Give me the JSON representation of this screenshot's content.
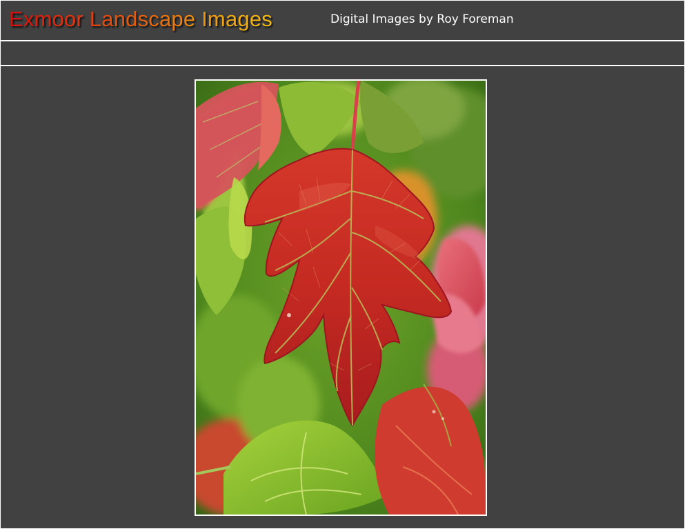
{
  "header": {
    "title": "Exmoor Landscape Images",
    "tagline": "Digital Images by Roy Foreman"
  },
  "nav": {
    "items": []
  },
  "main": {
    "photo": {
      "subject": "red-leaf-photo"
    }
  },
  "colors": {
    "background": "#414141",
    "rule": "#ffffff",
    "title_gradient_start": "#d40f0f",
    "title_gradient_end": "#f3bb16",
    "tagline": "#ffffff"
  }
}
